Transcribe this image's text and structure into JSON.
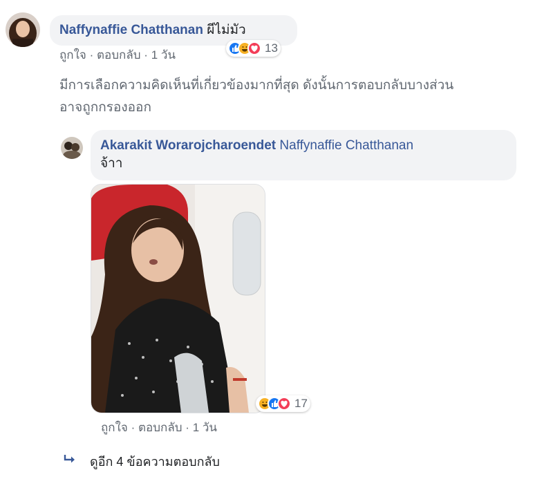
{
  "comment": {
    "author": "Naffynaffie Chatthanan",
    "text": "ผีไม่มัว",
    "actions": {
      "like": "ถูกใจ",
      "sep": "·",
      "reply": "ตอบกลับ",
      "time": "1 วัน"
    },
    "reactions": {
      "icons": [
        "like-icon",
        "haha-icon",
        "love-icon"
      ],
      "count": "13"
    }
  },
  "filter_note": {
    "line1": "มีการเลือกความคิดเห็นที่เกี่ยวข้องมากที่สุด ดังนั้นการตอบกลับบางส่วน",
    "line2": "อาจถูกกรองออก"
  },
  "reply": {
    "author": "Akarakit Worarojcharoendet",
    "tagged": "Naffynaffie Chatthanan",
    "text": "จ้าา",
    "actions": {
      "like": "ถูกใจ",
      "sep": "·",
      "reply": "ตอบกลับ",
      "time": "1 วัน"
    },
    "reactions": {
      "icons": [
        "haha-icon",
        "like-icon",
        "love-icon"
      ],
      "count": "17"
    }
  },
  "more_replies": {
    "label": "ดูอีก 4 ข้อความตอบกลับ"
  },
  "colors": {
    "link_blue": "#385898",
    "bubble_bg": "#f2f3f5",
    "meta_gray": "#606770",
    "like_blue": "#1877f2",
    "love_red": "#f33e58",
    "haha_yellow": "#f7b125"
  }
}
